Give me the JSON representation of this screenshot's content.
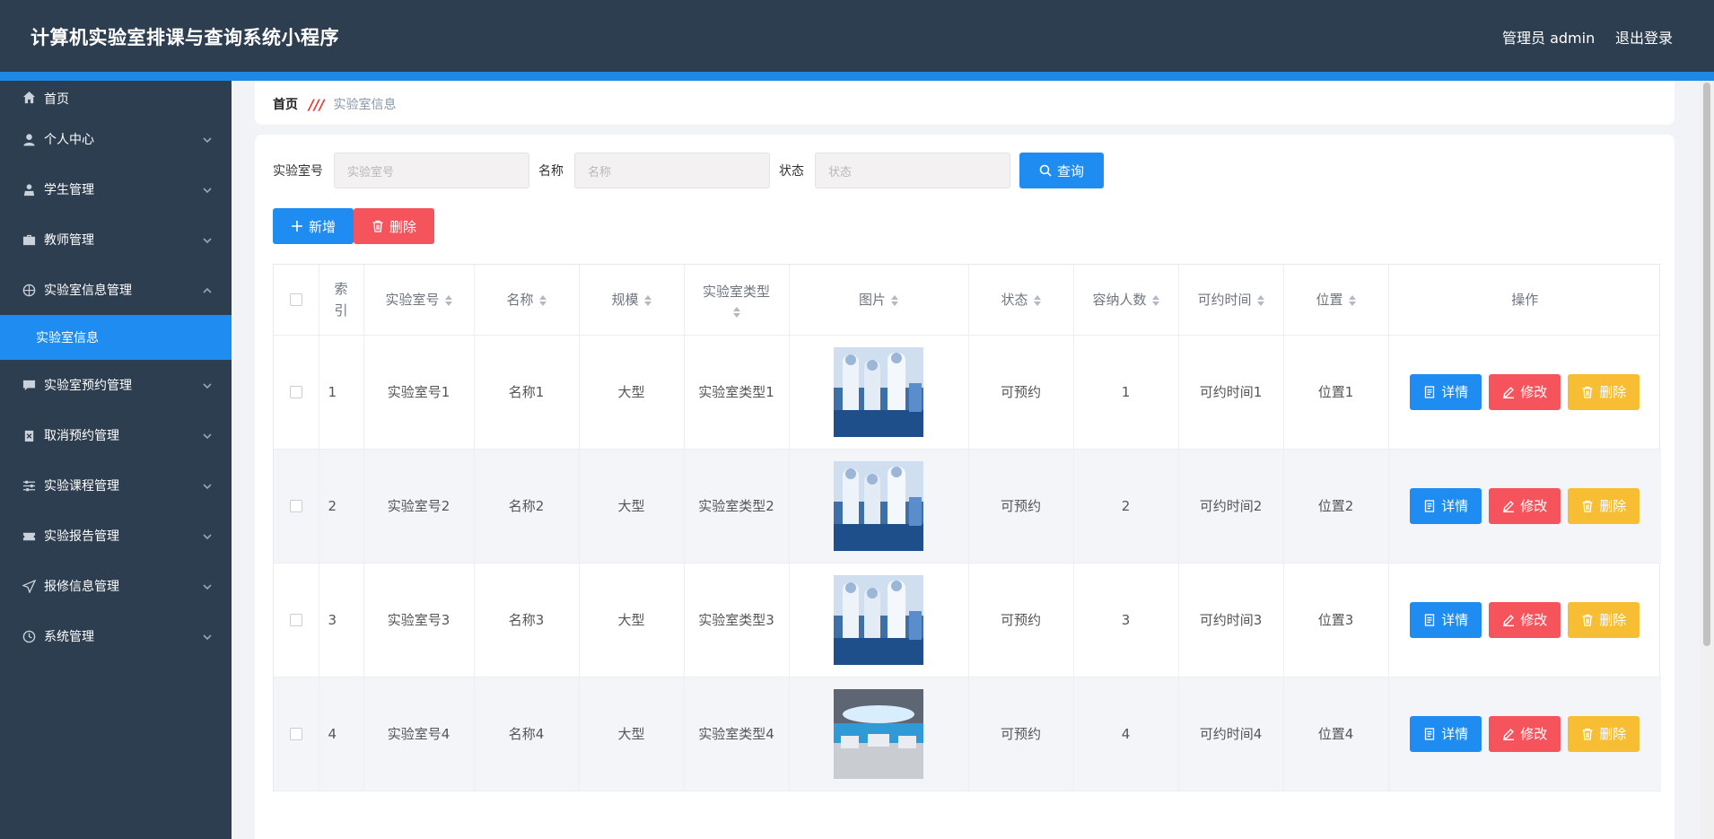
{
  "header": {
    "title": "计算机实验室排课与查询系统小程序",
    "user": "管理员 admin",
    "logout": "退出登录"
  },
  "colors": {
    "header_bg": "#2d3e50",
    "accent": "#1e8cf0",
    "danger": "#f5545c",
    "warning": "#f7bd33"
  },
  "sidebar": {
    "items": [
      {
        "label": "首页",
        "icon": "home-icon"
      },
      {
        "label": "个人中心",
        "icon": "user-icon"
      },
      {
        "label": "学生管理",
        "icon": "student-icon"
      },
      {
        "label": "教师管理",
        "icon": "briefcase-icon"
      },
      {
        "label": "实验室信息管理",
        "icon": "compass-icon"
      },
      {
        "label": "实验室预约管理",
        "icon": "chat-icon"
      },
      {
        "label": "取消预约管理",
        "icon": "clipboard-icon"
      },
      {
        "label": "实验课程管理",
        "icon": "sliders-icon"
      },
      {
        "label": "实验报告管理",
        "icon": "ticket-icon"
      },
      {
        "label": "报修信息管理",
        "icon": "send-icon"
      },
      {
        "label": "系统管理",
        "icon": "clock-icon"
      }
    ],
    "active_sub": "实验室信息"
  },
  "breadcrumb": {
    "home": "首页",
    "current": "实验室信息"
  },
  "search": {
    "fields": [
      {
        "label": "实验室号",
        "placeholder": "实验室号"
      },
      {
        "label": "名称",
        "placeholder": "名称"
      },
      {
        "label": "状态",
        "placeholder": "状态"
      }
    ],
    "button": "查询"
  },
  "actions": {
    "add": "新增",
    "delete": "删除"
  },
  "table": {
    "headers": {
      "index": "索引",
      "lab_no": "实验室号",
      "name": "名称",
      "scale": "规模",
      "type": "实验室类型",
      "image": "图片",
      "status": "状态",
      "capacity": "容纳人数",
      "time": "可约时间",
      "location": "位置",
      "ops": "操作"
    },
    "rows": [
      {
        "index": "1",
        "lab_no": "实验室号1",
        "name": "名称1",
        "scale": "大型",
        "type": "实验室类型1",
        "status": "可预约",
        "capacity": "1",
        "time": "可约时间1",
        "location": "位置1"
      },
      {
        "index": "2",
        "lab_no": "实验室号2",
        "name": "名称2",
        "scale": "大型",
        "type": "实验室类型2",
        "status": "可预约",
        "capacity": "2",
        "time": "可约时间2",
        "location": "位置2"
      },
      {
        "index": "3",
        "lab_no": "实验室号3",
        "name": "名称3",
        "scale": "大型",
        "type": "实验室类型3",
        "status": "可预约",
        "capacity": "3",
        "time": "可约时间3",
        "location": "位置3"
      },
      {
        "index": "4",
        "lab_no": "实验室号4",
        "name": "名称4",
        "scale": "大型",
        "type": "实验室类型4",
        "status": "可预约",
        "capacity": "4",
        "time": "可约时间4",
        "location": "位置4"
      }
    ],
    "row_buttons": {
      "detail": "详情",
      "edit": "修改",
      "delete": "删除"
    }
  }
}
